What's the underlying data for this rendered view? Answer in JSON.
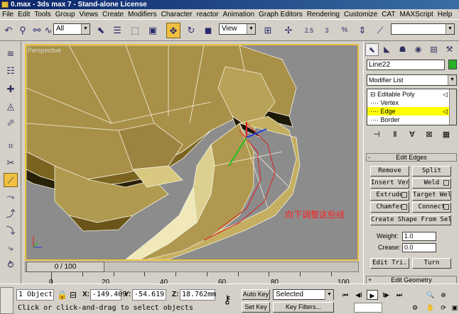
{
  "window": {
    "title": "0.max - 3ds max 7 - Stand-alone License"
  },
  "menu": [
    "File",
    "Edit",
    "Tools",
    "Group",
    "Views",
    "Create",
    "Modifiers",
    "Character",
    "reactor",
    "Animation",
    "Graph Editors",
    "Rendering",
    "Customize",
    "CAT",
    "MAXScript",
    "Help"
  ],
  "toolbar": {
    "filter_value": "All",
    "refcoord_value": "View",
    "snap_label": "2.5",
    "angle_label": "3",
    "percent_label": "%"
  },
  "viewport": {
    "label": "Perspective",
    "annotation": "向下调整这些线",
    "colors": {
      "border": "#e8c040",
      "background": "#8c8c8c",
      "mesh": "#b8a050",
      "selected_edge": "#e02020",
      "wire": "#ffffff"
    }
  },
  "timeline": {
    "position": "0 / 100",
    "ruler_labels": [
      "0",
      "20",
      "40",
      "60",
      "80",
      "100"
    ]
  },
  "command_panel": {
    "object_name": "Line22",
    "object_color": "#28b028",
    "modifier_list": "Modifier List",
    "stack": [
      {
        "label": "Editable Poly",
        "prefix": "⊟"
      },
      {
        "label": "Vertex",
        "prefix": "····"
      },
      {
        "label": "Edge",
        "prefix": "····"
      },
      {
        "label": "Border",
        "prefix": "····"
      }
    ],
    "edit_edges": {
      "title": "Edit Edges",
      "buttons": [
        "Remove",
        "Split",
        "Insert Vertex",
        "Weld",
        "Extrude",
        "Target Weld",
        "Chamfer",
        "Connect",
        "Create Shape From Selection"
      ],
      "weight_label": "Weight:",
      "weight_value": "1.0",
      "crease_label": "Crease:",
      "crease_value": "0.0",
      "edit_tri_label": "Edit Tri.",
      "turn_label": "Turn"
    },
    "edit_geometry_title": "Edit Geometry"
  },
  "status": {
    "selection_count": "1 Object",
    "x_label": "X:",
    "x_value": "-149.409",
    "y_label": "Y:",
    "y_value": "-54.619",
    "z_label": "Z:",
    "z_value": "18.762mm",
    "prompt": "Click or click-and-drag to select objects",
    "auto_key": "Auto Key",
    "set_key": "Set Key",
    "selected_filter": "Selected",
    "key_filters": "Key Filters..."
  }
}
